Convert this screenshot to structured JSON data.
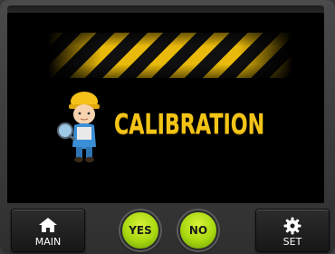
{
  "screen": {
    "title": "CALIBRATION",
    "illustration": "worker-with-hard-hat",
    "banner": "hazard-stripes"
  },
  "buttons": {
    "main": {
      "label": "MAIN",
      "icon": "home-icon"
    },
    "yes": {
      "label": "YES"
    },
    "no": {
      "label": "NO"
    },
    "set": {
      "label": "SET",
      "icon": "gear-icon"
    }
  },
  "colors": {
    "title": "#f3c417",
    "stripe_yellow": "#f6c40c",
    "round_button": "#a8d80f",
    "screen_bg": "#000000"
  }
}
